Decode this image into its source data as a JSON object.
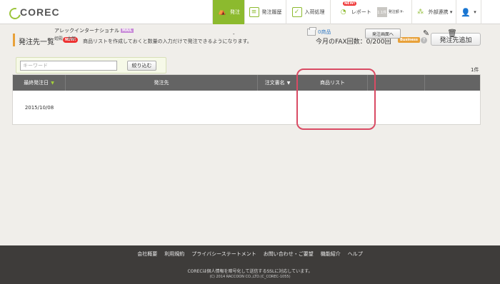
{
  "header": {
    "logo_text": "COREC",
    "nav": {
      "order": "発注",
      "history": "発注履歴",
      "receive": "入荷処理",
      "report": "レポート",
      "report_badge": "NEW!",
      "report_count": "1.1件",
      "report_sub": "発注額 ¥-",
      "external": "外部連携 ▾",
      "user": "▾"
    }
  },
  "main": {
    "title": "発注先一覧",
    "title_badge": "NEW!",
    "description": "商品リストを作成しておくと数量の入力だけで発注できるようになります。",
    "fax_label": "今月のFAX回数：0/200回",
    "business_badge": "Business",
    "help": "?",
    "add_button": "発注先追加",
    "search": {
      "placeholder": "キーワード",
      "value": "",
      "filter_button": "絞り込む"
    },
    "count": "1件"
  },
  "table": {
    "columns": [
      "最終発注日",
      "発注先",
      "注文書名",
      "商品リスト",
      "",
      ""
    ],
    "sort_arrows": [
      "▼",
      "▼"
    ],
    "rows": [
      {
        "date": "2015/10/08",
        "destination": "アレックインターナショナル",
        "mail_badge": "MAIL",
        "contact": "姫殿　太郎",
        "doc_name": "-",
        "product_link": "0商品",
        "order_button": "発注画面へ"
      }
    ]
  },
  "footer": {
    "links": [
      "会社概要",
      "利用規約",
      "プライバシーステートメント",
      "お問い合わせ・ご要望",
      "機能紹介",
      "ヘルプ"
    ],
    "line1": "CORECは個人情報を暗号化して送信するSSLに対応しています。",
    "line2": "(C) 2014 RACCOON CO.,LTD.(C_COREC-1055)"
  },
  "colors": {
    "accent_green": "#8cba2e",
    "accent_orange": "#e8a13a",
    "highlight": "#d94b64",
    "header_gray": "#646464",
    "footer_bg": "#3e3c3a"
  }
}
